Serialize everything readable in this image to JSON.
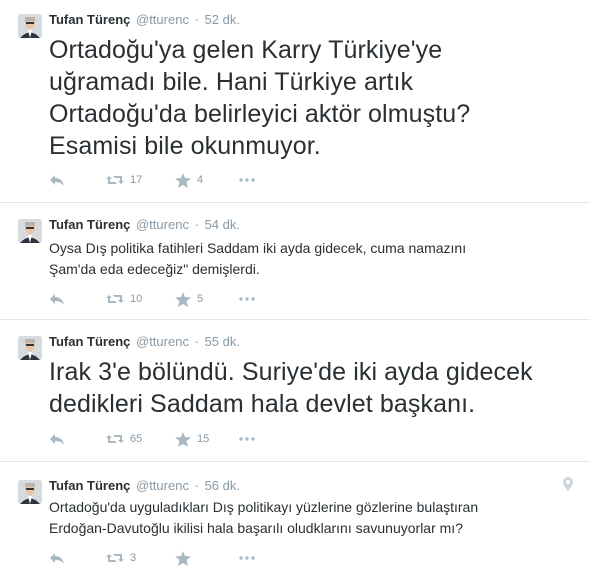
{
  "tweets": [
    {
      "fullname": "Tufan Türenç",
      "username": "@tturenc",
      "dot": "·",
      "time": "52 dk.",
      "lines": [
        "Ortadoğu'ya gelen Karry Türkiye'ye",
        "uğramadı bile. Hani Türkiye artık",
        "Ortadoğu'da belirleyici aktör olmuştu?",
        "Esamisi bile okunmuyor."
      ],
      "retweets": "17",
      "favorites": "4"
    },
    {
      "fullname": "Tufan Türenç",
      "username": "@tturenc",
      "dot": "·",
      "time": "54 dk.",
      "lines": [
        "Oysa Dış politika fatihleri Saddam iki ayda gidecek, cuma namazını",
        "Şam'da eda edeceğiz\" demişlerdi."
      ],
      "retweets": "10",
      "favorites": "5"
    },
    {
      "fullname": "Tufan Türenç",
      "username": "@tturenc",
      "dot": "·",
      "time": "55 dk.",
      "lines": [
        "Irak 3'e bölündü. Suriye'de iki ayda gidecek",
        "dedikleri Saddam hala devlet başkanı."
      ],
      "retweets": "65",
      "favorites": "15"
    },
    {
      "fullname": "Tufan Türenç",
      "username": "@tturenc",
      "dot": "·",
      "time": "56 dk.",
      "lines": [
        "Ortadoğu'da uyguladıkları Dış politikayı yüzlerine gözlerine bulaştıran",
        "Erdoğan-Davutoğlu ikilisi hala başarılı oludklarını savunuyorlar mı?"
      ],
      "retweets": "3",
      "favorites": ""
    }
  ],
  "icons": {
    "reply": "reply-icon",
    "retweet": "retweet-icon",
    "favorite": "star-icon",
    "more": "more-icon",
    "location": "location-pin-icon"
  },
  "colors": {
    "text": "#292f33",
    "meta": "#8899a6",
    "action": "#aab8c2",
    "divider": "#e1e8ed"
  }
}
